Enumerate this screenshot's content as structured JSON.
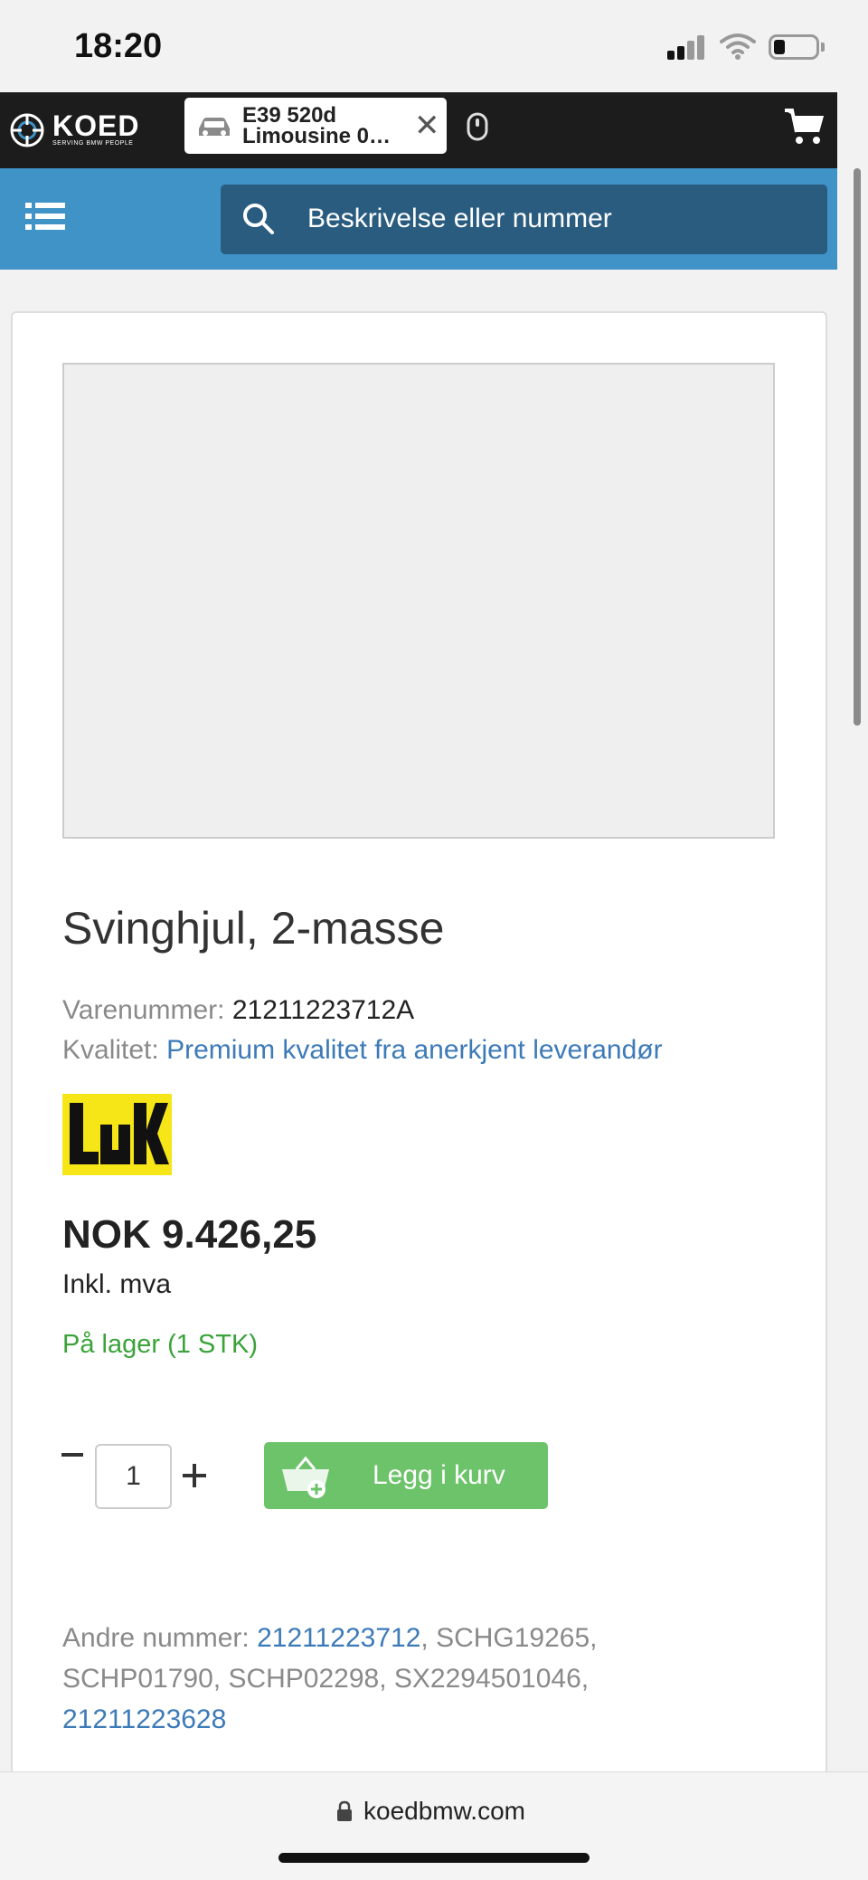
{
  "status_bar": {
    "time": "18:20"
  },
  "header": {
    "logo_name": "KOED",
    "logo_tagline": "SERVING BMW PEOPLE",
    "vehicle_line1": "E39 520d",
    "vehicle_line2": "Limousine 0…",
    "close_symbol": "✕"
  },
  "search": {
    "placeholder": "Beskrivelse eller nummer"
  },
  "product": {
    "title": "Svinghjul, 2-masse",
    "part_number_label": "Varenummer:",
    "part_number": "21211223712A",
    "quality_label": "Kvalitet:",
    "quality_value": "Premium kvalitet fra anerkjent leverandør",
    "brand": "LuK",
    "price": "NOK 9.426,25",
    "vat_note": "Inkl. mva",
    "stock": "På lager (1 STK)",
    "quantity": "1",
    "add_to_cart_label": "Legg i kurv",
    "other_numbers_label": "Andre nummer:",
    "other_numbers": {
      "link1": "21211223712",
      "plain": ", SCHG19265, SCHP01790, SCHP02298, SX2294501046,",
      "link2": "21211223628"
    }
  },
  "browser": {
    "url": "koedbmw.com"
  },
  "colors": {
    "nav_dark": "#1c1c1c",
    "brand_blue": "#3f93c6",
    "search_dark_blue": "#2a5c80",
    "link_blue": "#3d7ab8",
    "stock_green": "#3aa33a",
    "cart_button_green": "#6dc36a",
    "luk_yellow": "#f7e617"
  },
  "icons": [
    "signal-icon",
    "wifi-icon",
    "battery-icon",
    "koed-logo-icon",
    "car-icon",
    "close-icon",
    "scroll-mouse-icon",
    "cart-icon",
    "menu-icon",
    "search-icon",
    "luk-brand-logo",
    "minus-icon",
    "plus-icon",
    "basket-add-icon",
    "lock-icon"
  ]
}
